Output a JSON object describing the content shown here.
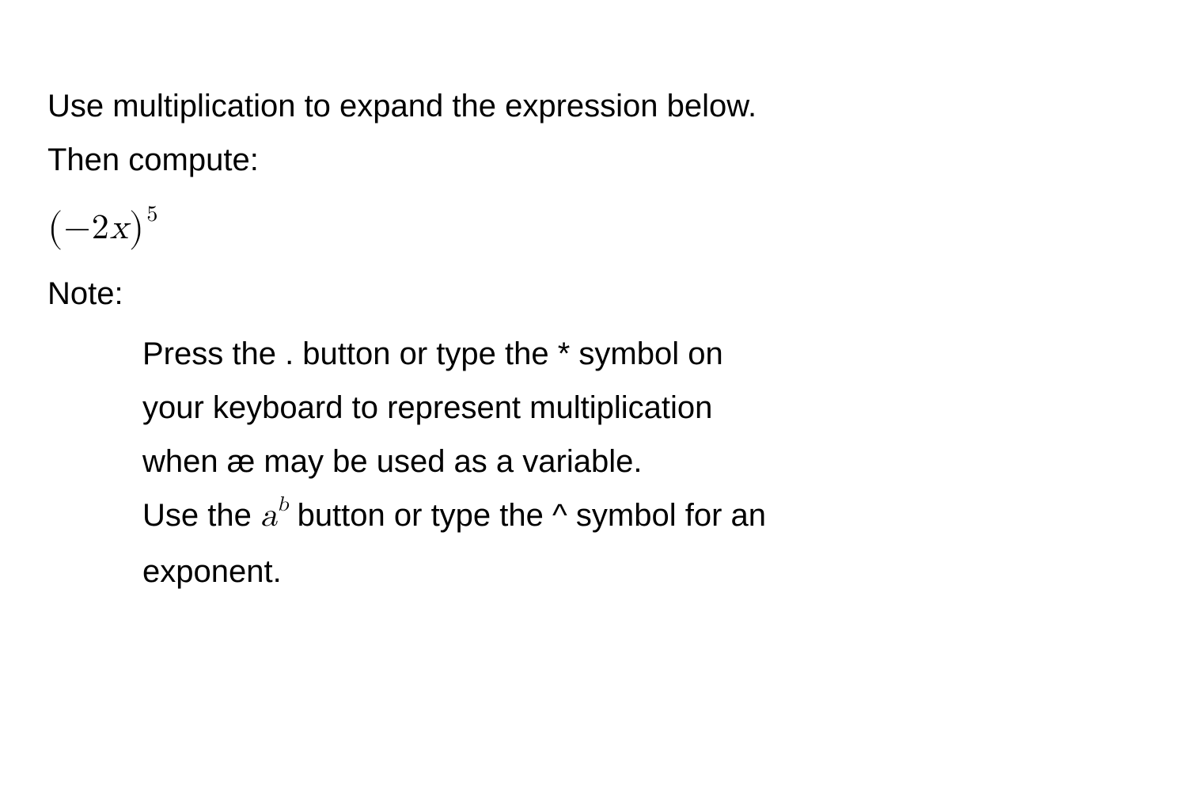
{
  "instruction": {
    "line1": "Use multiplication to expand the expression below.",
    "line2": "Then compute:"
  },
  "expression": {
    "lparen": "(",
    "minus": "−",
    "coef": "2",
    "var": "x",
    "rparen": ")",
    "exp": "5"
  },
  "note_label": "Note:",
  "note1": {
    "line1": "Press the . button or type the * symbol on",
    "line2": "your keyboard to represent multiplication",
    "line3": "when æ may be used as a variable."
  },
  "note2": {
    "prefix": "Use the ",
    "base": "a",
    "exp": "b",
    "middle": " button or type the ^ symbol for an",
    "line2": "exponent."
  }
}
